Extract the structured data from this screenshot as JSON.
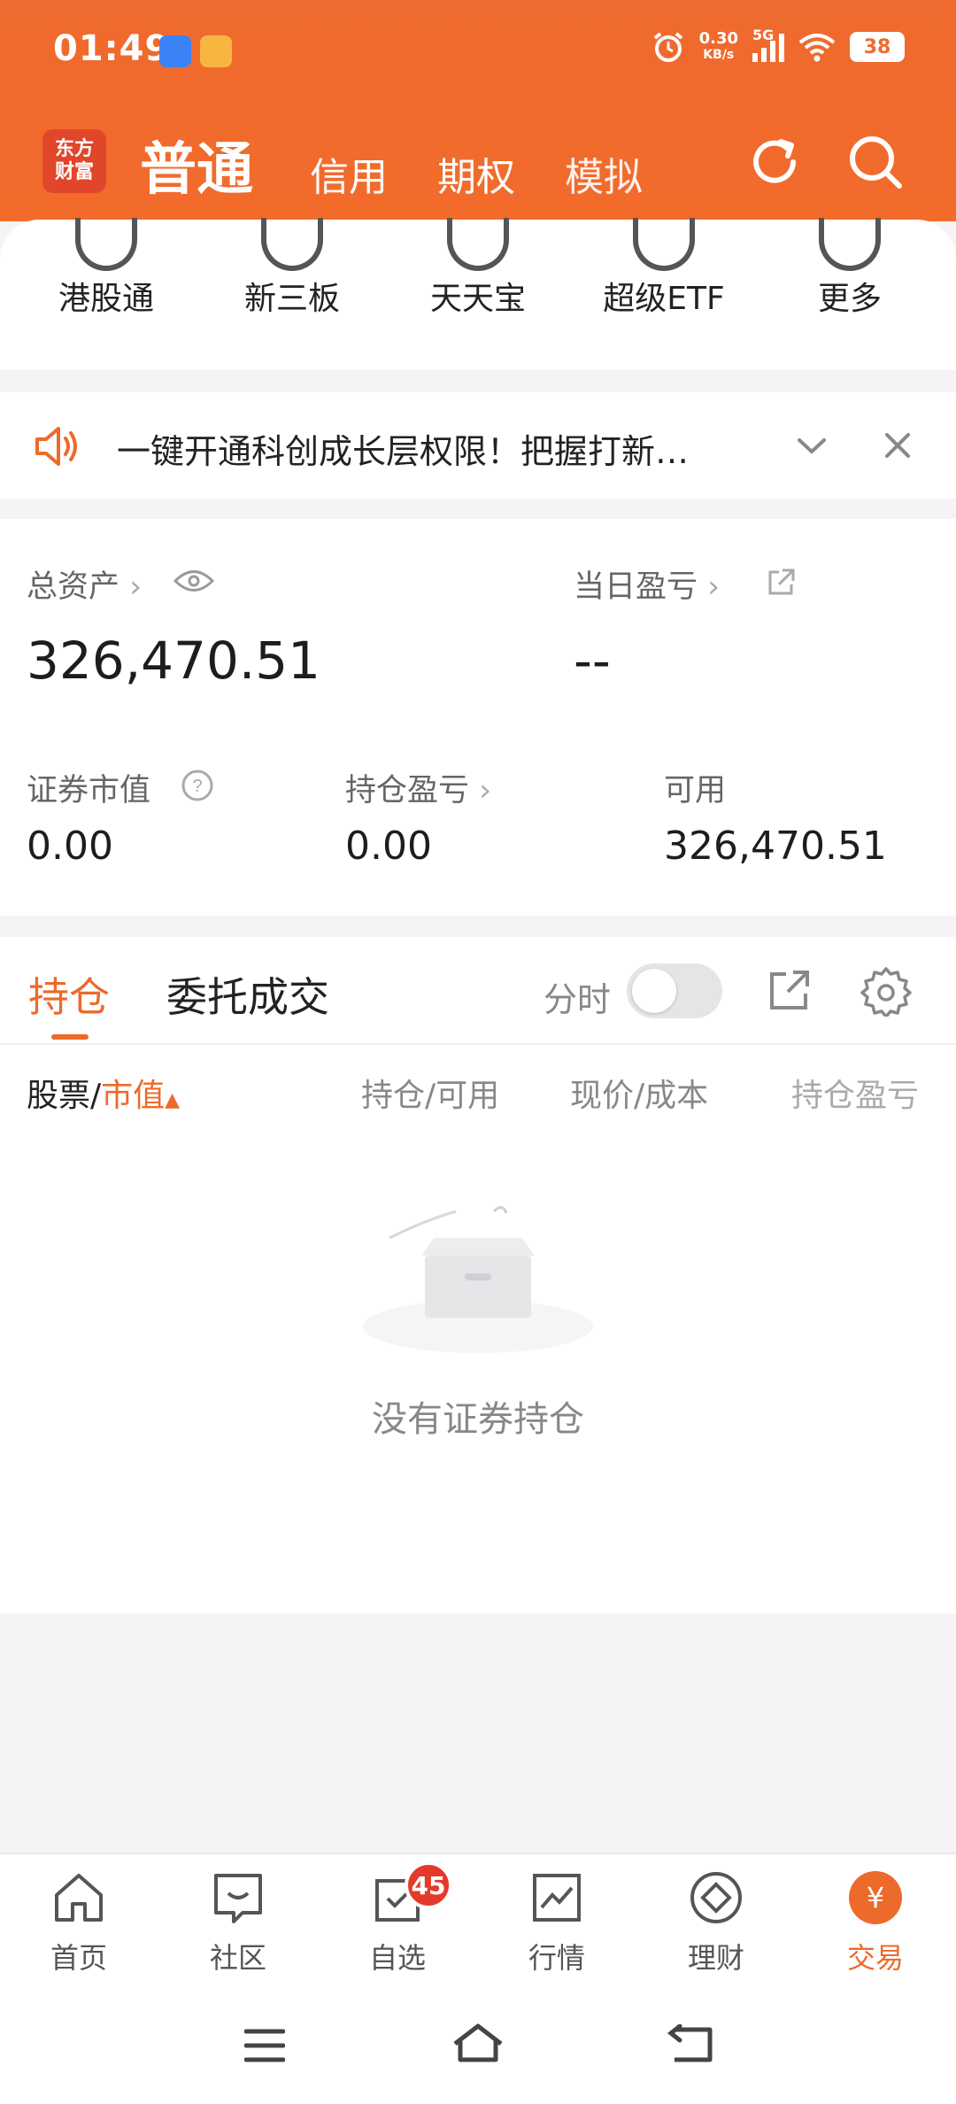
{
  "status": {
    "time": "01:49",
    "net_speed_value": "0.30",
    "net_speed_unit": "KB/s",
    "network": "5G",
    "battery": "38"
  },
  "header": {
    "logo_line1": "东方",
    "logo_line2": "财富",
    "tabs": [
      {
        "label": "普通",
        "active": true
      },
      {
        "label": "信用"
      },
      {
        "label": "期权"
      },
      {
        "label": "模拟"
      }
    ]
  },
  "shortcuts": [
    "港股通",
    "新三板",
    "天天宝",
    "超级ETF",
    "更多"
  ],
  "notice": {
    "text": "一键开通科创成长层权限！把握打新…"
  },
  "assets": {
    "total_label": "总资产",
    "total_value": "326,470.51",
    "daily_pl_label": "当日盈亏",
    "daily_pl_value": "--",
    "market_value_label": "证券市值",
    "market_value": "0.00",
    "position_pl_label": "持仓盈亏",
    "position_pl": "0.00",
    "available_label": "可用",
    "available": "326,470.51"
  },
  "holdings": {
    "tab_positions": "持仓",
    "tab_orders": "委托成交",
    "fenshi_label": "分时",
    "col_stock": "股票/",
    "col_market_value": "市值",
    "col_position_available": "持仓/可用",
    "col_price_cost": "现价/成本",
    "col_position_pl": "持仓盈亏",
    "empty_text": "没有证券持仓"
  },
  "bottom_nav": [
    {
      "label": "首页",
      "icon": "home-icon"
    },
    {
      "label": "社区",
      "icon": "community-icon"
    },
    {
      "label": "自选",
      "icon": "watchlist-icon",
      "badge": "45"
    },
    {
      "label": "行情",
      "icon": "market-icon"
    },
    {
      "label": "理财",
      "icon": "wealth-icon"
    },
    {
      "label": "交易",
      "icon": "trade-icon",
      "active": true
    }
  ],
  "colors": {
    "brand": "#ef6a2e",
    "accent": "#ec6a2a",
    "badge": "#e43a2b"
  }
}
